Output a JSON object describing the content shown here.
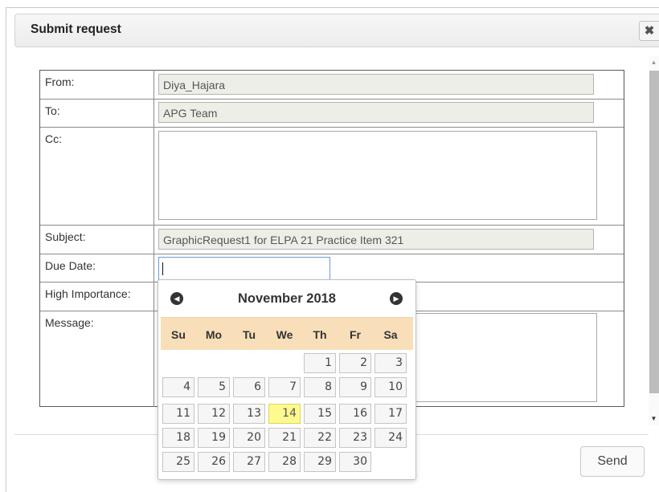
{
  "dialog": {
    "title": "Submit request",
    "close_icon": "close-icon"
  },
  "form": {
    "from": {
      "label": "From:",
      "value": "Diya_Hajara"
    },
    "to": {
      "label": "To:",
      "value": "APG Team"
    },
    "cc": {
      "label": "Cc:",
      "value": ""
    },
    "subject": {
      "label": "Subject:",
      "value": "GraphicRequest1 for ELPA 21 Practice Item 321"
    },
    "due_date": {
      "label": "Due Date:",
      "value": ""
    },
    "high_importance": {
      "label": "High Importance:"
    },
    "message": {
      "label": "Message:",
      "value": ""
    }
  },
  "footer": {
    "send_label": "Send"
  },
  "datepicker": {
    "month_year": "November 2018",
    "prev_icon": "prev-month-icon",
    "next_icon": "next-month-icon",
    "weekdays": [
      "Su",
      "Mo",
      "Tu",
      "We",
      "Th",
      "Fr",
      "Sa"
    ],
    "weeks": [
      [
        "",
        "",
        "",
        "",
        "1",
        "2",
        "3"
      ],
      [
        "4",
        "5",
        "6",
        "7",
        "8",
        "9",
        "10"
      ],
      [
        "11",
        "12",
        "13",
        "14",
        "15",
        "16",
        "17"
      ],
      [
        "18",
        "19",
        "20",
        "21",
        "22",
        "23",
        "24"
      ],
      [
        "25",
        "26",
        "27",
        "28",
        "29",
        "30",
        ""
      ]
    ],
    "today": "14",
    "today_color": "#fffa90",
    "header_color": "#f8dfb9"
  }
}
